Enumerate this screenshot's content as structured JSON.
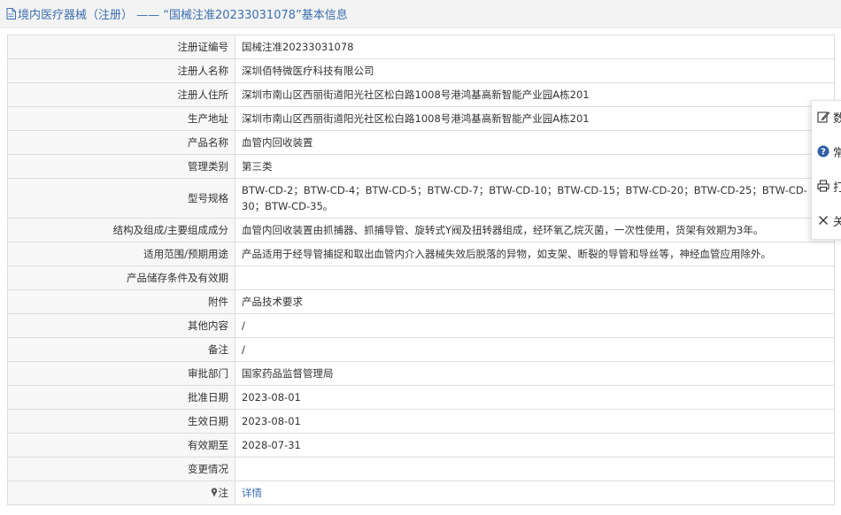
{
  "header": {
    "section": "境内医疗器械（注册）",
    "separator": "——",
    "record_title": "“国械注准20233031078”基本信息"
  },
  "rows": [
    {
      "label": "注册证编号",
      "value": "国械注准20233031078"
    },
    {
      "label": "注册人名称",
      "value": "深圳佰特微医疗科技有限公司"
    },
    {
      "label": "注册人住所",
      "value": "深圳市南山区西丽街道阳光社区松白路1008号港鸿基高新智能产业园A栋201"
    },
    {
      "label": "生产地址",
      "value": "深圳市南山区西丽街道阳光社区松白路1008号港鸿基高新智能产业园A栋201"
    },
    {
      "label": "产品名称",
      "value": "血管内回收装置"
    },
    {
      "label": "管理类别",
      "value": "第三类"
    },
    {
      "label": "型号规格",
      "value": "BTW-CD-2；BTW-CD-4；BTW-CD-5；BTW-CD-7；BTW-CD-10；BTW-CD-15；BTW-CD-20；BTW-CD-25；BTW-CD-30；BTW-CD-35。"
    },
    {
      "label": "结构及组成/主要组成成分",
      "value": "血管内回收装置由抓捕器、抓捕导管、旋转式Y阀及扭转器组成，经环氧乙烷灭菌，一次性使用，货架有效期为3年。"
    },
    {
      "label": "适用范围/预期用途",
      "value": "产品适用于经导管捕捉和取出血管内介入器械失效后脱落的异物，如支架、断裂的导管和导丝等，神经血管应用除外。"
    },
    {
      "label": "产品储存条件及有效期",
      "value": ""
    },
    {
      "label": "附件",
      "value": "产品技术要求"
    },
    {
      "label": "其他内容",
      "value": "/"
    },
    {
      "label": "备注",
      "value": "/"
    },
    {
      "label": "审批部门",
      "value": "国家药品监督管理局"
    },
    {
      "label": "批准日期",
      "value": "2023-08-01"
    },
    {
      "label": "生效日期",
      "value": "2023-08-01"
    },
    {
      "label": "有效期至",
      "value": "2028-07-31"
    },
    {
      "label": "变更情况",
      "value": ""
    },
    {
      "label": "注",
      "value": "详情"
    }
  ],
  "side_panel": [
    {
      "icon": "edit-icon",
      "label": "数"
    },
    {
      "icon": "help-icon",
      "label": "常"
    },
    {
      "icon": "print-icon",
      "label": "打"
    },
    {
      "icon": "close-icon",
      "label": "关"
    }
  ],
  "colors": {
    "accent": "#3d6fae",
    "label_bg": "#f7f7f7",
    "border": "#dddddd",
    "titlebar_bg": "#f3f3f3"
  }
}
